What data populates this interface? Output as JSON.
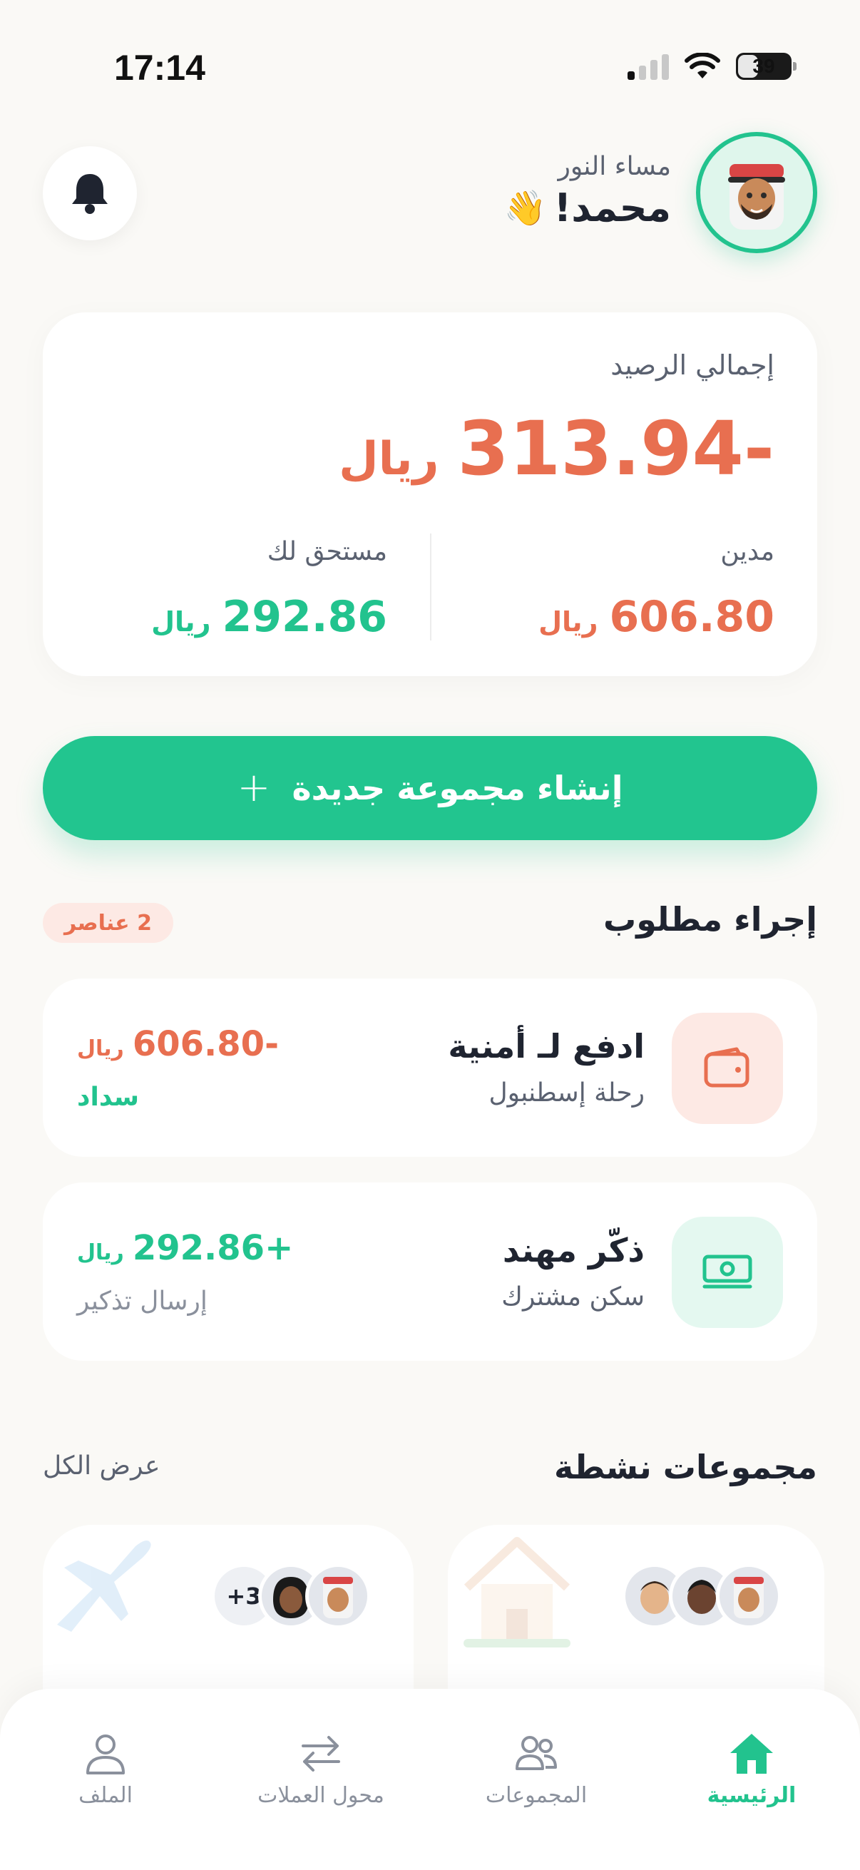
{
  "status_bar": {
    "time": "17:14",
    "battery": "39",
    "battery_level": 0.39
  },
  "header": {
    "greeting": "مساء النور",
    "name": "محمد!",
    "wave_emoji": "👋",
    "avatar_icon": "user-avatar-icon",
    "bell_icon": "bell-icon"
  },
  "balance": {
    "label": "إجمالي الرصيد",
    "total_amount": "313.94-",
    "currency": "ريال",
    "owed_label": "مدين",
    "owed_amount": "606.80",
    "due_label": "مستحق لك",
    "due_amount": "292.86"
  },
  "create_group": {
    "label": "إنشاء مجموعة جديدة",
    "plus": "+"
  },
  "action_required": {
    "title": "إجراء مطلوب",
    "badge": "2 عناصر",
    "items": [
      {
        "title": "ادفع لـ أمنية",
        "subtitle": "رحلة إسطنبول",
        "amount": "606.80-",
        "currency": "ريال",
        "action": "سداد",
        "icon": "wallet-icon"
      },
      {
        "title": "ذكّر مهند",
        "subtitle": "سكن مشترك",
        "amount": "292.86+",
        "currency": "ريال",
        "action": "إرسال تذكير",
        "icon": "cash-icon"
      }
    ]
  },
  "active_groups": {
    "title": "مجموعات نشطة",
    "see_all": "عرض الكل",
    "groups": [
      {
        "art": "house-icon",
        "members": 3
      },
      {
        "art": "airplane-icon",
        "members": 2,
        "more": "+3"
      }
    ]
  },
  "bottom_nav": {
    "items": [
      {
        "label": "الرئيسية",
        "icon": "home-icon",
        "active": true
      },
      {
        "label": "المجموعات",
        "icon": "groups-icon",
        "active": false
      },
      {
        "label": "محول العملات",
        "icon": "currency-converter-icon",
        "active": false
      },
      {
        "label": "الملف",
        "icon": "profile-icon",
        "active": false
      }
    ]
  },
  "colors": {
    "accent": "#22c38e",
    "negative": "#e86f50",
    "background": "#faf9f6"
  }
}
